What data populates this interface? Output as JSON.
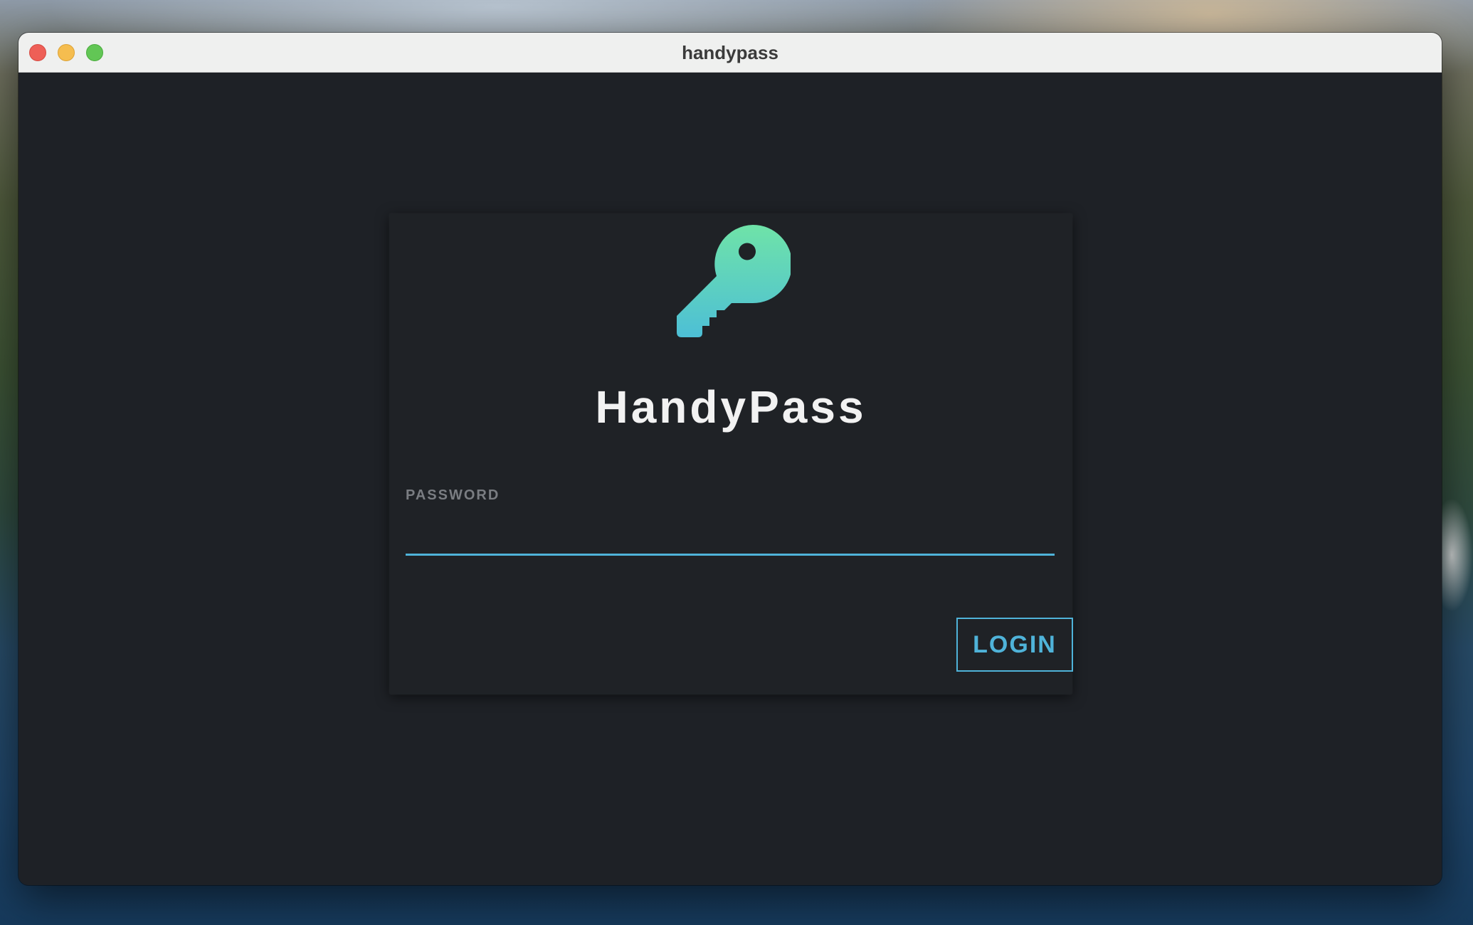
{
  "window": {
    "title": "handypass"
  },
  "login_card": {
    "logo_icon": "key-icon",
    "app_name": "HandyPass",
    "password_label": "PASSWORD",
    "password_value": "",
    "password_placeholder": "",
    "login_label": "LOGIN"
  },
  "colors": {
    "accent": "#4fb3d9",
    "logo_gradient_top": "#6fe3a8",
    "logo_gradient_bottom": "#4dbfd6",
    "background": "#1e2126",
    "titlebar": "#eff0ef"
  }
}
